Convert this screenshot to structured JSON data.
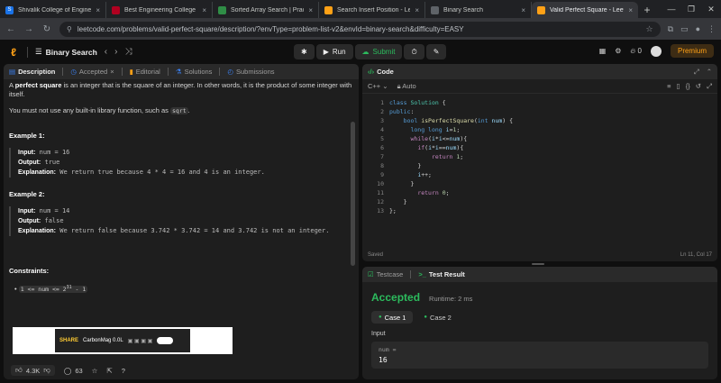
{
  "browser": {
    "tabs": [
      {
        "title": "Shivalik College of Enginee",
        "color": "#1a73e8",
        "glyph": "S",
        "active": false
      },
      {
        "title": "Best Engineering College |",
        "color": "#b00020",
        "glyph": "",
        "active": false
      },
      {
        "title": "Sorted Array Search | Prac",
        "color": "#2f8d46",
        "glyph": "",
        "active": false
      },
      {
        "title": "Search Insert Position - Le",
        "color": "#ffa116",
        "glyph": "",
        "active": false
      },
      {
        "title": "Binary Search",
        "color": "#5f6368",
        "glyph": "",
        "active": false
      },
      {
        "title": "Valid Perfect Square - Leet",
        "color": "#ffa116",
        "glyph": "",
        "active": true
      }
    ],
    "url": "leetcode.com/problems/valid-perfect-square/description/?envType=problem-list-v2&envId=binary-search&difficulty=EASY"
  },
  "header": {
    "problem_list": "Binary Search",
    "run": "Run",
    "submit": "Submit",
    "points": "0",
    "premium": "Premium"
  },
  "tabs_left": [
    "Description",
    "Accepted",
    "Editorial",
    "Solutions",
    "Submissions"
  ],
  "description": {
    "bold_term": "perfect square",
    "intro_pre": "A ",
    "intro_post": " is an integer that is the square of an integer. In other words, it is the product of some integer with itself.",
    "note_pre": "You must not use any built-in library function, such as ",
    "note_code": "sqrt",
    "note_post": ".",
    "examples": [
      {
        "title": "Example 1:",
        "input": "num = 16",
        "output": "true",
        "explanation": "We return true because 4 * 4 = 16 and 4 is an integer."
      },
      {
        "title": "Example 2:",
        "input": "num = 14",
        "output": "false",
        "explanation": "We return false because 3.742 * 3.742 = 14 and 3.742 is not an integer."
      }
    ],
    "labels": {
      "input": "Input:",
      "output": "Output:",
      "explanation": "Explanation:"
    },
    "constraints_title": "Constraints:",
    "constraint": "1 <= num <= 2",
    "constraint_exp": "31",
    "constraint_tail": " - 1"
  },
  "ad": {
    "brand": "SHARE",
    "name": "CarbonMag 0.0L"
  },
  "stats": {
    "likes": "4.3K",
    "comments": "63"
  },
  "code_panel": {
    "title": "Code",
    "language": "C++",
    "mode": "Auto",
    "saved": "Saved",
    "cursor": "Ln 11, Col 17"
  },
  "result_panel": {
    "tab_testcase": "Testcase",
    "tab_result": "Test Result",
    "status": "Accepted",
    "runtime": "Runtime: 2 ms",
    "case1": "Case 1",
    "case2": "Case 2",
    "input_label": "Input",
    "var_name": "num =",
    "var_value": "16"
  }
}
